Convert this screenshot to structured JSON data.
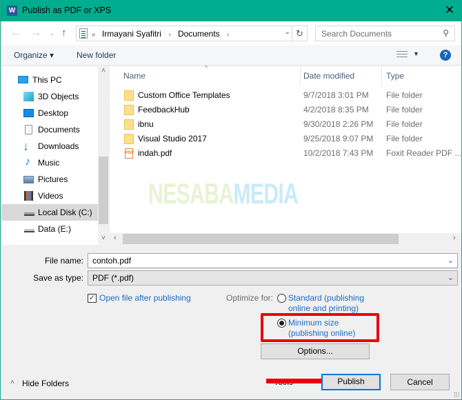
{
  "window": {
    "title": "Publish as PDF or XPS",
    "app_icon": "W",
    "close_glyph": "✕",
    "accent_color": "#00ad8f"
  },
  "navigation": {
    "back_glyph": "←",
    "forward_glyph": "→",
    "recent_glyph": "⌄",
    "up_glyph": "↑",
    "breadcrumb": [
      "«",
      "Irmayani Syafitri",
      "Documents"
    ],
    "refresh_glyph": "↻",
    "dropdown_glyph": "⌄",
    "search_placeholder": "Search Documents",
    "search_glyph": "⚲"
  },
  "toolbar": {
    "organize_label": "Organize ▾",
    "new_folder_label": "New folder",
    "views_dropdown_glyph": "▼",
    "help_glyph": "?"
  },
  "sidebar": {
    "items": [
      {
        "label": "This PC",
        "icon": "computer-icon",
        "selected": false
      },
      {
        "label": "3D Objects",
        "icon": "3d-objects-icon",
        "selected": false
      },
      {
        "label": "Desktop",
        "icon": "desktop-icon",
        "selected": false
      },
      {
        "label": "Documents",
        "icon": "documents-icon",
        "selected": false
      },
      {
        "label": "Downloads",
        "icon": "downloads-icon",
        "selected": false
      },
      {
        "label": "Music",
        "icon": "music-icon",
        "selected": false
      },
      {
        "label": "Pictures",
        "icon": "pictures-icon",
        "selected": false
      },
      {
        "label": "Videos",
        "icon": "videos-icon",
        "selected": false
      },
      {
        "label": "Local Disk (C:)",
        "icon": "local-disk-icon",
        "selected": true
      },
      {
        "label": "Data (E:)",
        "icon": "drive-icon",
        "selected": false
      }
    ],
    "scroll_up_glyph": "˄",
    "scroll_down_glyph": "˅"
  },
  "file_list": {
    "columns": [
      "Name",
      "Date modified",
      "Type"
    ],
    "sort_glyph": "^",
    "rows": [
      {
        "name": "Custom Office Templates",
        "date": "9/7/2018 3:01 PM",
        "type": "File folder",
        "icon": "folder"
      },
      {
        "name": "FeedbackHub",
        "date": "4/2/2018 8:35 PM",
        "type": "File folder",
        "icon": "folder"
      },
      {
        "name": "ibnu",
        "date": "9/30/2018 2:26 PM",
        "type": "File folder",
        "icon": "folder"
      },
      {
        "name": "Visual Studio 2017",
        "date": "9/25/2018 9:07 PM",
        "type": "File folder",
        "icon": "folder"
      },
      {
        "name": "indah.pdf",
        "date": "10/2/2018 7:43 PM",
        "type": "Foxit Reader PDF ...",
        "icon": "pdf"
      }
    ],
    "pdf_icon_text": "PDF",
    "watermark_part1": "NESABA",
    "watermark_part2": "MEDIA",
    "hscroll_left_glyph": "‹",
    "hscroll_right_glyph": "›"
  },
  "form": {
    "file_name_label": "File name:",
    "file_name_value": "contoh.pdf",
    "save_type_label": "Save as type:",
    "save_type_value": "PDF (*.pdf)",
    "chevron_glyph": "⌄",
    "open_after_label": "Open file after publishing",
    "open_after_checked": true,
    "check_glyph": "✓",
    "optimize_label": "Optimize for:",
    "optimize_options": [
      {
        "line1": "Standard (publishing",
        "line2": "online and printing)",
        "selected": false
      },
      {
        "line1": "Minimum size",
        "line2": "(publishing online)",
        "selected": true
      }
    ],
    "options_button": "Options..."
  },
  "footer": {
    "hide_folders_glyph": "˄",
    "hide_folders_label": "Hide Folders",
    "tools_label": "Tools",
    "publish_label": "Publish",
    "cancel_label": "Cancel"
  },
  "annotations": {
    "highlight_color": "#e8000f"
  }
}
